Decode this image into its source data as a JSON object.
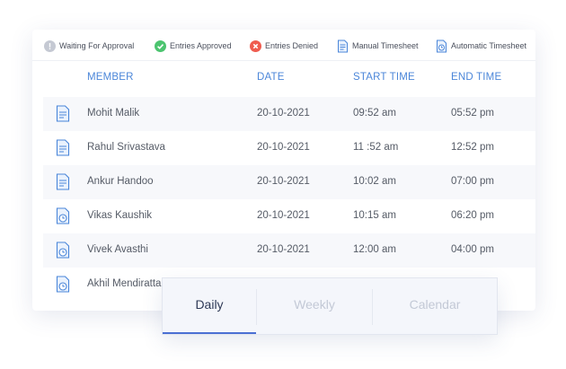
{
  "legend": [
    {
      "label": "Waiting For Approval",
      "icon": "pending-icon",
      "color": "#c5c9d3"
    },
    {
      "label": "Entries Approved",
      "icon": "check-circle-icon",
      "color": "#4cc46f"
    },
    {
      "label": "Entries Denied",
      "icon": "denied-icon",
      "color": "#ef5c4f"
    },
    {
      "label": "Manual Timesheet",
      "icon": "manual-timesheet-icon",
      "color": "#4a86d9"
    },
    {
      "label": "Automatic Timesheet",
      "icon": "automatic-timesheet-icon",
      "color": "#4a86d9"
    }
  ],
  "table": {
    "headers": [
      "MEMBER",
      "DATE",
      "START TIME",
      "END TIME"
    ],
    "rows": [
      {
        "member": "Mohit Malik",
        "date": "20-10-2021",
        "start": "09:52 am",
        "end": "05:52 pm",
        "icon": "manual-timesheet-icon"
      },
      {
        "member": "Rahul Srivastava",
        "date": "20-10-2021",
        "start": "11 :52 am",
        "end": "12:52 pm",
        "icon": "manual-timesheet-icon"
      },
      {
        "member": "Ankur Handoo",
        "date": "20-10-2021",
        "start": "10:02 am",
        "end": "07:00 pm",
        "icon": "manual-timesheet-icon"
      },
      {
        "member": "Vikas Kaushik",
        "date": "20-10-2021",
        "start": "10:15 am",
        "end": "06:20 pm",
        "icon": "automatic-timesheet-icon"
      },
      {
        "member": "Vivek Avasthi",
        "date": "20-10-2021",
        "start": "12:00 am",
        "end": "04:00 pm",
        "icon": "automatic-timesheet-icon"
      },
      {
        "member": "Akhil Mendiratta",
        "date": "",
        "start": "",
        "end": "",
        "icon": "automatic-timesheet-icon"
      }
    ]
  },
  "tabs": {
    "items": [
      {
        "label": "Daily",
        "active": true
      },
      {
        "label": "Weekly",
        "active": false
      },
      {
        "label": "Calendar",
        "active": false
      }
    ],
    "accent": "#4a6fd3"
  }
}
